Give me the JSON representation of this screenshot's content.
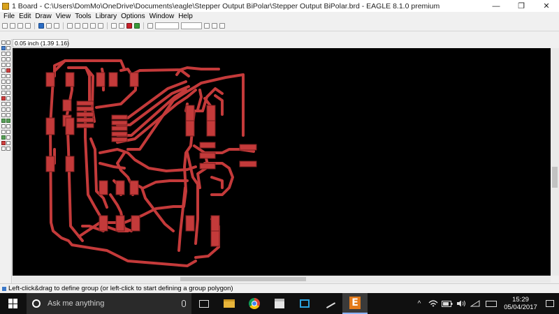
{
  "window": {
    "title": "1 Board - C:\\Users\\DomMo\\OneDrive\\Documents\\eagle\\Stepper Output BiPolar\\Stepper Output BiPolar.brd - EAGLE 8.1.0 premium",
    "minimize_glyph": "—",
    "maximize_glyph": "❐",
    "close_glyph": "✕"
  },
  "menu": [
    "File",
    "Edit",
    "Draw",
    "View",
    "Tools",
    "Library",
    "Options",
    "Window",
    "Help"
  ],
  "coordinate_readout": "0.05 inch (1.39 1.16)",
  "status_text": "Left-click&drag to define group (or left-click to start defining a group polygon)",
  "canvas": {
    "background": "#000000",
    "trace_color": "#c43a3a"
  },
  "taskbar": {
    "search_placeholder": "Ask me anything",
    "eagle_letter": "E",
    "tray_chevron": "^",
    "clock_time": "15:29",
    "clock_date": "05/04/2017"
  },
  "icons": {
    "app": "eagle-app-icon",
    "search": "cortana-search-icon",
    "mic": "microphone-icon",
    "taskview": "task-view-icon",
    "explorer": "file-explorer-icon",
    "chrome": "chrome-icon",
    "store": "store-icon",
    "remote": "remote-desktop-icon",
    "tool": "tool-icon",
    "battery": "battery-icon",
    "volume": "volume-icon",
    "wifi": "wifi-icon",
    "keyboard": "keyboard-icon",
    "notifications": "notifications-icon"
  }
}
